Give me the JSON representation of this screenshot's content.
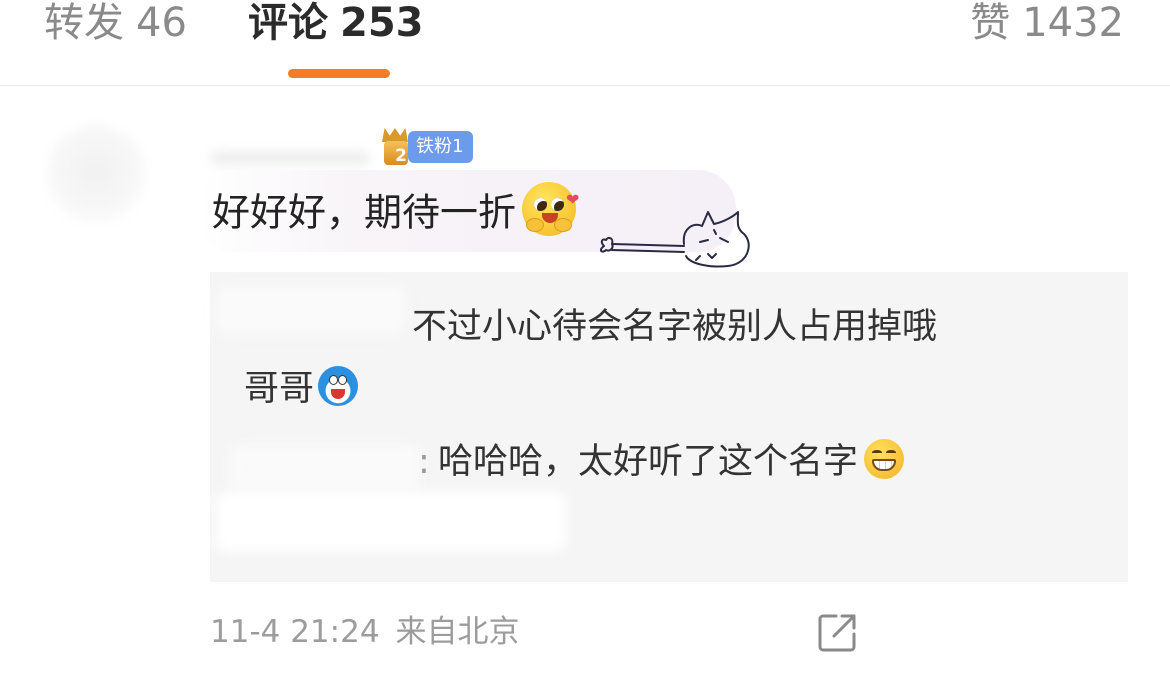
{
  "tabs": [
    {
      "label": "转发",
      "count": "46"
    },
    {
      "label": "评论",
      "count": "253"
    },
    {
      "label": "赞",
      "count": "1432"
    }
  ],
  "comment": {
    "fan_badge": {
      "level_digit": "2",
      "label": "铁粉1"
    },
    "text": "好好好，期待一折",
    "replies": [
      {
        "line1": "不过小心待会名字被别人占用掉哦",
        "line2": "哥哥"
      },
      {
        "colon": ":",
        "text": "哈哈哈，太好听了这个名字"
      }
    ],
    "time": "11-4 21:24",
    "location": "来自北京"
  },
  "icons": {
    "emoji_1": "blushing-face-icon",
    "emoji_2": "doraemon-icon",
    "emoji_3": "grinning-face-icon",
    "share": "share-icon"
  },
  "colors": {
    "accent": "#f47d2c",
    "badge": "#6d9bec"
  }
}
